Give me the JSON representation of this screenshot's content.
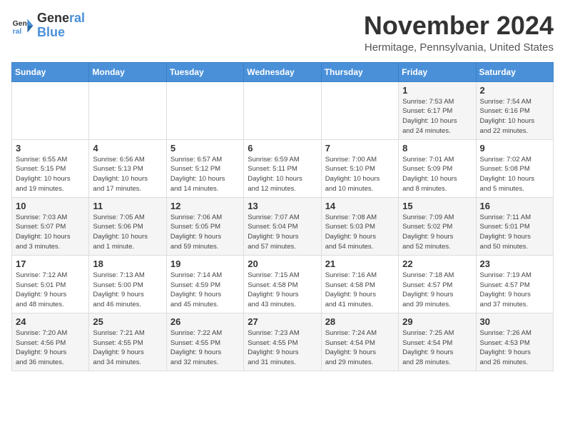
{
  "logo": {
    "line1": "General",
    "line2": "Blue"
  },
  "title": "November 2024",
  "location": "Hermitage, Pennsylvania, United States",
  "weekdays": [
    "Sunday",
    "Monday",
    "Tuesday",
    "Wednesday",
    "Thursday",
    "Friday",
    "Saturday"
  ],
  "weeks": [
    [
      {
        "day": "",
        "detail": ""
      },
      {
        "day": "",
        "detail": ""
      },
      {
        "day": "",
        "detail": ""
      },
      {
        "day": "",
        "detail": ""
      },
      {
        "day": "",
        "detail": ""
      },
      {
        "day": "1",
        "detail": "Sunrise: 7:53 AM\nSunset: 6:17 PM\nDaylight: 10 hours\nand 24 minutes."
      },
      {
        "day": "2",
        "detail": "Sunrise: 7:54 AM\nSunset: 6:16 PM\nDaylight: 10 hours\nand 22 minutes."
      }
    ],
    [
      {
        "day": "3",
        "detail": "Sunrise: 6:55 AM\nSunset: 5:15 PM\nDaylight: 10 hours\nand 19 minutes."
      },
      {
        "day": "4",
        "detail": "Sunrise: 6:56 AM\nSunset: 5:13 PM\nDaylight: 10 hours\nand 17 minutes."
      },
      {
        "day": "5",
        "detail": "Sunrise: 6:57 AM\nSunset: 5:12 PM\nDaylight: 10 hours\nand 14 minutes."
      },
      {
        "day": "6",
        "detail": "Sunrise: 6:59 AM\nSunset: 5:11 PM\nDaylight: 10 hours\nand 12 minutes."
      },
      {
        "day": "7",
        "detail": "Sunrise: 7:00 AM\nSunset: 5:10 PM\nDaylight: 10 hours\nand 10 minutes."
      },
      {
        "day": "8",
        "detail": "Sunrise: 7:01 AM\nSunset: 5:09 PM\nDaylight: 10 hours\nand 8 minutes."
      },
      {
        "day": "9",
        "detail": "Sunrise: 7:02 AM\nSunset: 5:08 PM\nDaylight: 10 hours\nand 5 minutes."
      }
    ],
    [
      {
        "day": "10",
        "detail": "Sunrise: 7:03 AM\nSunset: 5:07 PM\nDaylight: 10 hours\nand 3 minutes."
      },
      {
        "day": "11",
        "detail": "Sunrise: 7:05 AM\nSunset: 5:06 PM\nDaylight: 10 hours\nand 1 minute."
      },
      {
        "day": "12",
        "detail": "Sunrise: 7:06 AM\nSunset: 5:05 PM\nDaylight: 9 hours\nand 59 minutes."
      },
      {
        "day": "13",
        "detail": "Sunrise: 7:07 AM\nSunset: 5:04 PM\nDaylight: 9 hours\nand 57 minutes."
      },
      {
        "day": "14",
        "detail": "Sunrise: 7:08 AM\nSunset: 5:03 PM\nDaylight: 9 hours\nand 54 minutes."
      },
      {
        "day": "15",
        "detail": "Sunrise: 7:09 AM\nSunset: 5:02 PM\nDaylight: 9 hours\nand 52 minutes."
      },
      {
        "day": "16",
        "detail": "Sunrise: 7:11 AM\nSunset: 5:01 PM\nDaylight: 9 hours\nand 50 minutes."
      }
    ],
    [
      {
        "day": "17",
        "detail": "Sunrise: 7:12 AM\nSunset: 5:01 PM\nDaylight: 9 hours\nand 48 minutes."
      },
      {
        "day": "18",
        "detail": "Sunrise: 7:13 AM\nSunset: 5:00 PM\nDaylight: 9 hours\nand 46 minutes."
      },
      {
        "day": "19",
        "detail": "Sunrise: 7:14 AM\nSunset: 4:59 PM\nDaylight: 9 hours\nand 45 minutes."
      },
      {
        "day": "20",
        "detail": "Sunrise: 7:15 AM\nSunset: 4:58 PM\nDaylight: 9 hours\nand 43 minutes."
      },
      {
        "day": "21",
        "detail": "Sunrise: 7:16 AM\nSunset: 4:58 PM\nDaylight: 9 hours\nand 41 minutes."
      },
      {
        "day": "22",
        "detail": "Sunrise: 7:18 AM\nSunset: 4:57 PM\nDaylight: 9 hours\nand 39 minutes."
      },
      {
        "day": "23",
        "detail": "Sunrise: 7:19 AM\nSunset: 4:57 PM\nDaylight: 9 hours\nand 37 minutes."
      }
    ],
    [
      {
        "day": "24",
        "detail": "Sunrise: 7:20 AM\nSunset: 4:56 PM\nDaylight: 9 hours\nand 36 minutes."
      },
      {
        "day": "25",
        "detail": "Sunrise: 7:21 AM\nSunset: 4:55 PM\nDaylight: 9 hours\nand 34 minutes."
      },
      {
        "day": "26",
        "detail": "Sunrise: 7:22 AM\nSunset: 4:55 PM\nDaylight: 9 hours\nand 32 minutes."
      },
      {
        "day": "27",
        "detail": "Sunrise: 7:23 AM\nSunset: 4:55 PM\nDaylight: 9 hours\nand 31 minutes."
      },
      {
        "day": "28",
        "detail": "Sunrise: 7:24 AM\nSunset: 4:54 PM\nDaylight: 9 hours\nand 29 minutes."
      },
      {
        "day": "29",
        "detail": "Sunrise: 7:25 AM\nSunset: 4:54 PM\nDaylight: 9 hours\nand 28 minutes."
      },
      {
        "day": "30",
        "detail": "Sunrise: 7:26 AM\nSunset: 4:53 PM\nDaylight: 9 hours\nand 26 minutes."
      }
    ]
  ]
}
